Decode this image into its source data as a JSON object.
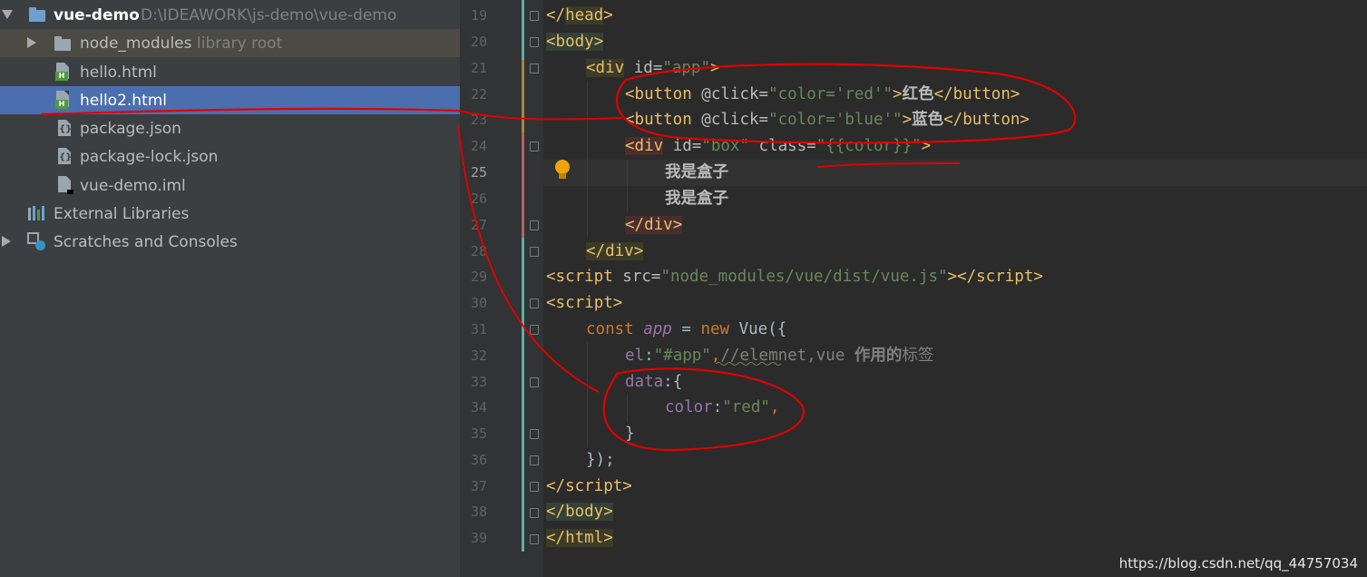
{
  "project_tree": {
    "root": {
      "name": "vue-demo",
      "path": "D:\\IDEAWORK\\js-demo\\vue-demo"
    },
    "node_modules": {
      "name": "node_modules",
      "hint": "library root"
    },
    "files": [
      {
        "name": "hello.html",
        "type": "html"
      },
      {
        "name": "hello2.html",
        "type": "html"
      },
      {
        "name": "package.json",
        "type": "json"
      },
      {
        "name": "package-lock.json",
        "type": "json"
      },
      {
        "name": "vue-demo.iml",
        "type": "iml"
      }
    ],
    "external_libraries": "External Libraries",
    "scratches": "Scratches and Consoles"
  },
  "editor": {
    "line_numbers": [
      "19",
      "20",
      "21",
      "22",
      "23",
      "24",
      "25",
      "26",
      "27",
      "28",
      "29",
      "30",
      "31",
      "32",
      "33",
      "34",
      "35",
      "36",
      "37",
      "38",
      "39"
    ],
    "code": {
      "l19": {
        "t1": "</",
        "t2": "head",
        "t3": ">"
      },
      "l20": {
        "t1": "<",
        "t2": "body",
        "t3": ">"
      },
      "l21": {
        "t1": "<div",
        "t2": " id=",
        "t3": "\"app\"",
        "t4": ">"
      },
      "l22": {
        "t1": "<button",
        "t2": " @click=",
        "t3": "\"color='red'\"",
        "t4": ">",
        "t5": "红色",
        "t6": "</button>"
      },
      "l23": {
        "t1": "<button",
        "t2": " @click=",
        "t3": "\"color='blue'\"",
        "t4": ">",
        "t5": "蓝色",
        "t6": "</button>"
      },
      "l24": {
        "t1": "<div",
        "t2": " id=",
        "t3": "\"box\"",
        "t4": " class=",
        "t5": "\"{{color}}\"",
        "t6": ">"
      },
      "l25": {
        "t1": "我是盒子"
      },
      "l26": {
        "t1": "我是盒子"
      },
      "l27": {
        "t1": "</",
        "t2": "div",
        "t3": ">"
      },
      "l28": {
        "t1": "</",
        "t2": "div",
        "t3": ">"
      },
      "l29": {
        "t1": "<script",
        "t2": " src=",
        "t3": "\"node_modules/vue/dist/vue.js\"",
        "t4": "></",
        "t5": "script",
        "t6": ">"
      },
      "l30": {
        "t1": "<",
        "t2": "script",
        "t3": ">"
      },
      "l31": {
        "t1": "const ",
        "t2": "app",
        "t3": " = ",
        "t4": "new ",
        "t5": "Vue({"
      },
      "l32": {
        "t1": "el",
        "t2": ":",
        "t3": "\"#app\"",
        "t4": ",",
        "t5": "//elemnet,vue ",
        "t6": "作用的",
        "t7": "标签"
      },
      "l33": {
        "t1": "data",
        "t2": ":{"
      },
      "l34": {
        "t1": "color",
        "t2": ":",
        "t3": "\"red\"",
        "t4": ","
      },
      "l35": {
        "t1": "}"
      },
      "l36": {
        "t1": "});"
      },
      "l37": {
        "t1": "</",
        "t2": "script",
        "t3": ">"
      },
      "l38": {
        "t1": "</",
        "t2": "body",
        "t3": ">"
      },
      "l39": {
        "t1": "</",
        "t2": "html",
        "t3": ">"
      }
    }
  },
  "watermark": "https://blog.csdn.net/qq_44757034",
  "colors": {
    "sidebar_bg": "#3c3f41",
    "selection": "#4b6eaf",
    "editor_bg": "#2b2b2b",
    "annotation_red": "#e00000"
  },
  "icons": [
    "expand-arrow-icon",
    "module-folder-icon",
    "folder-icon",
    "html-file-icon",
    "json-file-icon",
    "iml-file-icon",
    "libraries-icon",
    "scratches-icon",
    "lightbulb-icon",
    "fold-icon"
  ]
}
